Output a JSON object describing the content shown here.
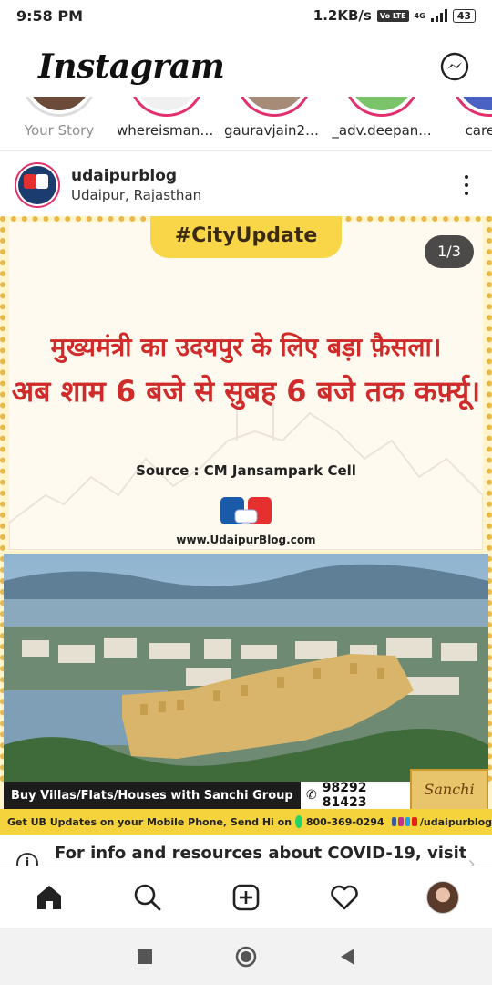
{
  "status_bar": {
    "time": "9:58 PM",
    "speed": "1.2KB/s",
    "volte": "Vo LTE",
    "network": "4G",
    "battery": "43"
  },
  "header": {
    "app_title": "Instagram",
    "messenger_icon": "messenger-icon"
  },
  "stories": [
    {
      "name": "Your Story",
      "own": true
    },
    {
      "name": "whereismant..."
    },
    {
      "name": "gauravjain20..."
    },
    {
      "name": "_adv.deepan..."
    },
    {
      "name": "carefre"
    }
  ],
  "post": {
    "username": "udaipurblog",
    "location": "Udaipur, Rajasthan",
    "counter": "1/3",
    "image": {
      "hashtag": "#CityUpdate",
      "headline_line1": "मुख्यमंत्री का उदयपुर के लिए  बड़ा फ़ैसला।",
      "headline_line2": "अब शाम 6 बजे से सुबह 6 बजे तक कर्फ़्यू।",
      "source": "Source : CM Jansampark Cell",
      "website": "www.UdaipurBlog.com",
      "buy_banner": "Buy Villas/Flats/Houses with Sanchi Group",
      "phone": "98292 81423",
      "sanchi_logo": "Sanchi",
      "updates_text": "Get UB Updates on your Mobile Phone, Send Hi on",
      "updates_number": "800-369-0294",
      "social_handle": "/udaipurblog"
    }
  },
  "covid_notice": {
    "text": "For info and resources about COVID-19, visit"
  },
  "bottom_nav": {
    "items": [
      "home-icon",
      "search-icon",
      "add-post-icon",
      "heart-icon",
      "profile-avatar"
    ]
  },
  "colors": {
    "accent": "#e1306c",
    "banner_yellow": "#f9d648",
    "headline_red": "#d02b2b"
  }
}
